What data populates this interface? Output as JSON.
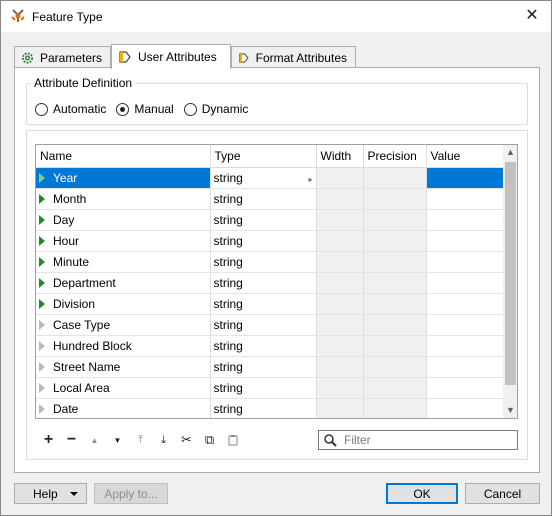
{
  "window": {
    "title": "Feature Type",
    "close_label": "✕"
  },
  "tabs": [
    {
      "label": "Parameters",
      "icon": "gear-icon",
      "active": false
    },
    {
      "label": "User Attributes",
      "icon": "attribute-tag-icon",
      "active": true
    },
    {
      "label": "Format Attributes",
      "icon": "attribute-tag-icon",
      "active": false
    }
  ],
  "attribute_definition": {
    "legend": "Attribute Definition",
    "options": [
      "Automatic",
      "Manual",
      "Dynamic"
    ],
    "selected": "Manual"
  },
  "table": {
    "columns": [
      "Name",
      "Type",
      "Width",
      "Precision",
      "Value"
    ],
    "rows": [
      {
        "name": "Year",
        "type": "string",
        "exposed": true,
        "selected": true
      },
      {
        "name": "Month",
        "type": "string",
        "exposed": true
      },
      {
        "name": "Day",
        "type": "string",
        "exposed": true
      },
      {
        "name": "Hour",
        "type": "string",
        "exposed": true
      },
      {
        "name": "Minute",
        "type": "string",
        "exposed": true
      },
      {
        "name": "Department",
        "type": "string",
        "exposed": true
      },
      {
        "name": "Division",
        "type": "string",
        "exposed": true
      },
      {
        "name": "Case Type",
        "type": "string",
        "exposed": false
      },
      {
        "name": "Hundred Block",
        "type": "string",
        "exposed": false
      },
      {
        "name": "Street Name",
        "type": "string",
        "exposed": false
      },
      {
        "name": "Local Area",
        "type": "string",
        "exposed": false
      },
      {
        "name": "Date",
        "type": "string",
        "exposed": false
      }
    ]
  },
  "toolbar": {
    "add": "+",
    "remove": "−",
    "move_up": "▲",
    "move_down": "▼",
    "move_top": "⤒",
    "move_bottom": "⤓",
    "cut": "✂",
    "copy": "⧉",
    "paste": "📋"
  },
  "filter": {
    "placeholder": "Filter",
    "value": ""
  },
  "buttons": {
    "help": "Help",
    "apply": "Apply to...",
    "ok": "OK",
    "cancel": "Cancel"
  },
  "colors": {
    "selection": "#0078d7",
    "exposed_arrow": "#228b22"
  }
}
